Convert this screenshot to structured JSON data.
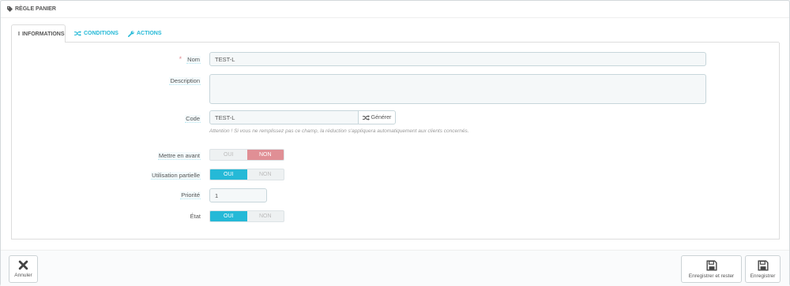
{
  "panel": {
    "title": "Règle panier",
    "icon": "tag-icon"
  },
  "tabs": [
    {
      "label": "Informations",
      "icon": "info-icon",
      "active": true
    },
    {
      "label": "Conditions",
      "icon": "random-icon",
      "active": false
    },
    {
      "label": "Actions",
      "icon": "wrench-icon",
      "active": false
    }
  ],
  "form": {
    "name": {
      "required_mark": "*",
      "label": "Nom",
      "value": "TEST-L"
    },
    "description": {
      "label": "Description",
      "value": ""
    },
    "code": {
      "label": "Code",
      "value": "TEST-L",
      "generate_label": "Générer",
      "help": "Attention ! Si vous ne remplissez pas ce champ, la réduction s'appliquera automatiquement aux clients concernés."
    },
    "highlight": {
      "label": "Mettre en avant",
      "yes": "OUI",
      "no": "NON",
      "value": "no"
    },
    "partial_use": {
      "label": "Utilisation partielle",
      "yes": "OUI",
      "no": "NON",
      "value": "yes"
    },
    "priority": {
      "label": "Priorité",
      "value": "1"
    },
    "status": {
      "label": "État",
      "yes": "OUI",
      "no": "NON",
      "value": "yes"
    }
  },
  "footer": {
    "cancel_label": "Annuler",
    "save_stay_label": "Enregistrer et rester",
    "save_label": "Enregistrer"
  },
  "colors": {
    "accent": "#25b9d7",
    "danger": "#e08f95"
  }
}
